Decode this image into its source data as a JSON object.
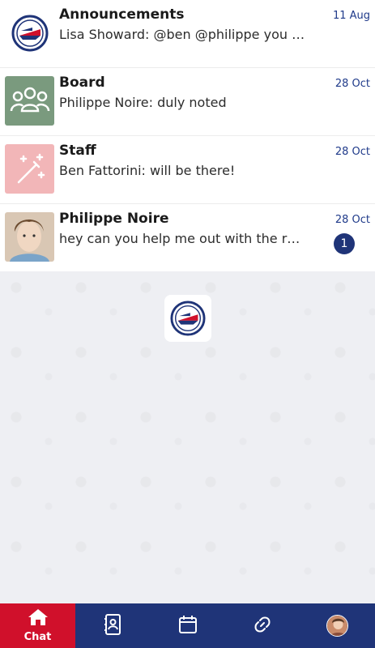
{
  "chats": [
    {
      "title": "Announcements",
      "preview": "Lisa Showard: @ben @philippe you …",
      "date": "11 Aug",
      "avatar": "club-logo-icon"
    },
    {
      "title": "Board",
      "preview": "Philippe Noire: duly noted",
      "date": "28 Oct",
      "avatar": "group-people-icon",
      "avatar_color": "#7a9a7e"
    },
    {
      "title": "Staff",
      "preview": "Ben Fattorini: will be there!",
      "date": "28 Oct",
      "avatar": "magic-wand-icon",
      "avatar_color": "#f2b6b8"
    },
    {
      "title": "Philippe Noire",
      "preview": "hey can you help me out with the r…",
      "date": "28 Oct",
      "avatar": "user-photo",
      "unread": "1"
    }
  ],
  "tabbar": {
    "tabs": [
      {
        "label": "Chat",
        "icon": "home-icon",
        "active": true
      },
      {
        "label": "",
        "icon": "contacts-icon"
      },
      {
        "label": "",
        "icon": "calendar-icon"
      },
      {
        "label": "",
        "icon": "link-icon"
      },
      {
        "label": "",
        "icon": "profile-avatar"
      }
    ]
  },
  "colors": {
    "brand_navy": "#1f3478",
    "brand_red": "#d0102b",
    "date_blue": "#1f3a8a"
  }
}
